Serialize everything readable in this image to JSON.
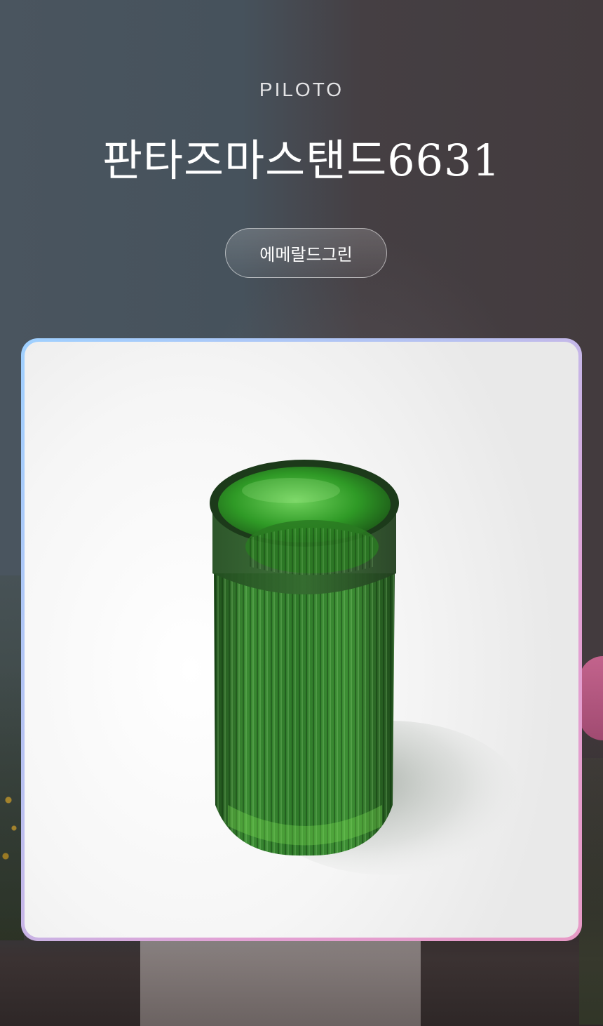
{
  "header": {
    "brand": "PILOTO",
    "product_title": "판타즈마스탠드6631"
  },
  "variant": {
    "label": "에메랄드그린"
  },
  "product_image": {
    "subject": "green-ribbed-glass-vase",
    "glass_color": "#2f7a2a"
  },
  "colors": {
    "card_border_start": "#9fd0ff",
    "card_border_end": "#e79ac6"
  }
}
